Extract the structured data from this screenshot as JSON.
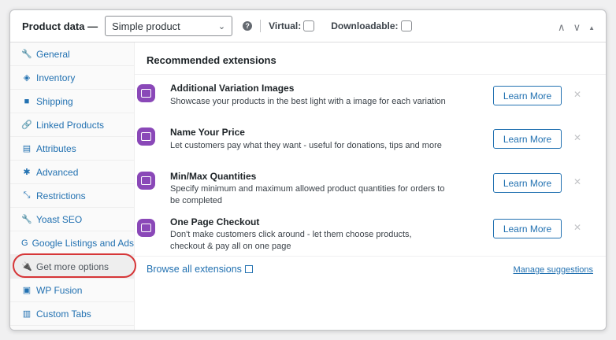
{
  "header": {
    "title": "Product data —",
    "product_type": "Simple product",
    "help": "?",
    "virtual_label": "Virtual:",
    "downloadable_label": "Downloadable:"
  },
  "sidebar": {
    "items": [
      {
        "label": "General",
        "icon": "wrench-icon",
        "glyph": "🔧"
      },
      {
        "label": "Inventory",
        "icon": "tag-icon",
        "glyph": "◈"
      },
      {
        "label": "Shipping",
        "icon": "truck-icon",
        "glyph": "■"
      },
      {
        "label": "Linked Products",
        "icon": "link-icon",
        "glyph": "🔗"
      },
      {
        "label": "Attributes",
        "icon": "list-table-icon",
        "glyph": "▤"
      },
      {
        "label": "Advanced",
        "icon": "gear-icon",
        "glyph": "✱"
      },
      {
        "label": "Restrictions",
        "icon": "restrictions-icon",
        "glyph": "⤡"
      },
      {
        "label": "Yoast SEO",
        "icon": "yoast-icon",
        "glyph": "🔧"
      },
      {
        "label": "Google Listings and Ads",
        "icon": "google-icon",
        "glyph": "G"
      },
      {
        "label": "Get more options",
        "icon": "plug-icon",
        "glyph": "🔌"
      },
      {
        "label": "WP Fusion",
        "icon": "wp-fusion-icon",
        "glyph": "▣"
      },
      {
        "label": "Custom Tabs",
        "icon": "tabs-icon",
        "glyph": "▥"
      }
    ]
  },
  "main": {
    "title": "Recommended extensions",
    "extensions": [
      {
        "title": "Additional Variation Images",
        "desc": "Showcase your products in the best light with a image for each variation",
        "button": "Learn More",
        "dismiss": "✕"
      },
      {
        "title": "Name Your Price",
        "desc": "Let customers pay what they want - useful for donations, tips and more",
        "button": "Learn More",
        "dismiss": "✕"
      },
      {
        "title": "Min/Max Quantities",
        "desc": "Specify minimum and maximum allowed product quantities for orders to be completed",
        "button": "Learn More",
        "dismiss": "✕"
      },
      {
        "title": "One Page Checkout",
        "desc": "Don't make customers click around - let them choose products, checkout & pay all on one page",
        "button": "Learn More",
        "dismiss": "✕"
      }
    ],
    "browse_label": "Browse all extensions",
    "manage_label": "Manage suggestions"
  },
  "colors": {
    "accent": "#2271b1",
    "extension_icon": "#8a48b8",
    "highlight": "#d63638"
  }
}
